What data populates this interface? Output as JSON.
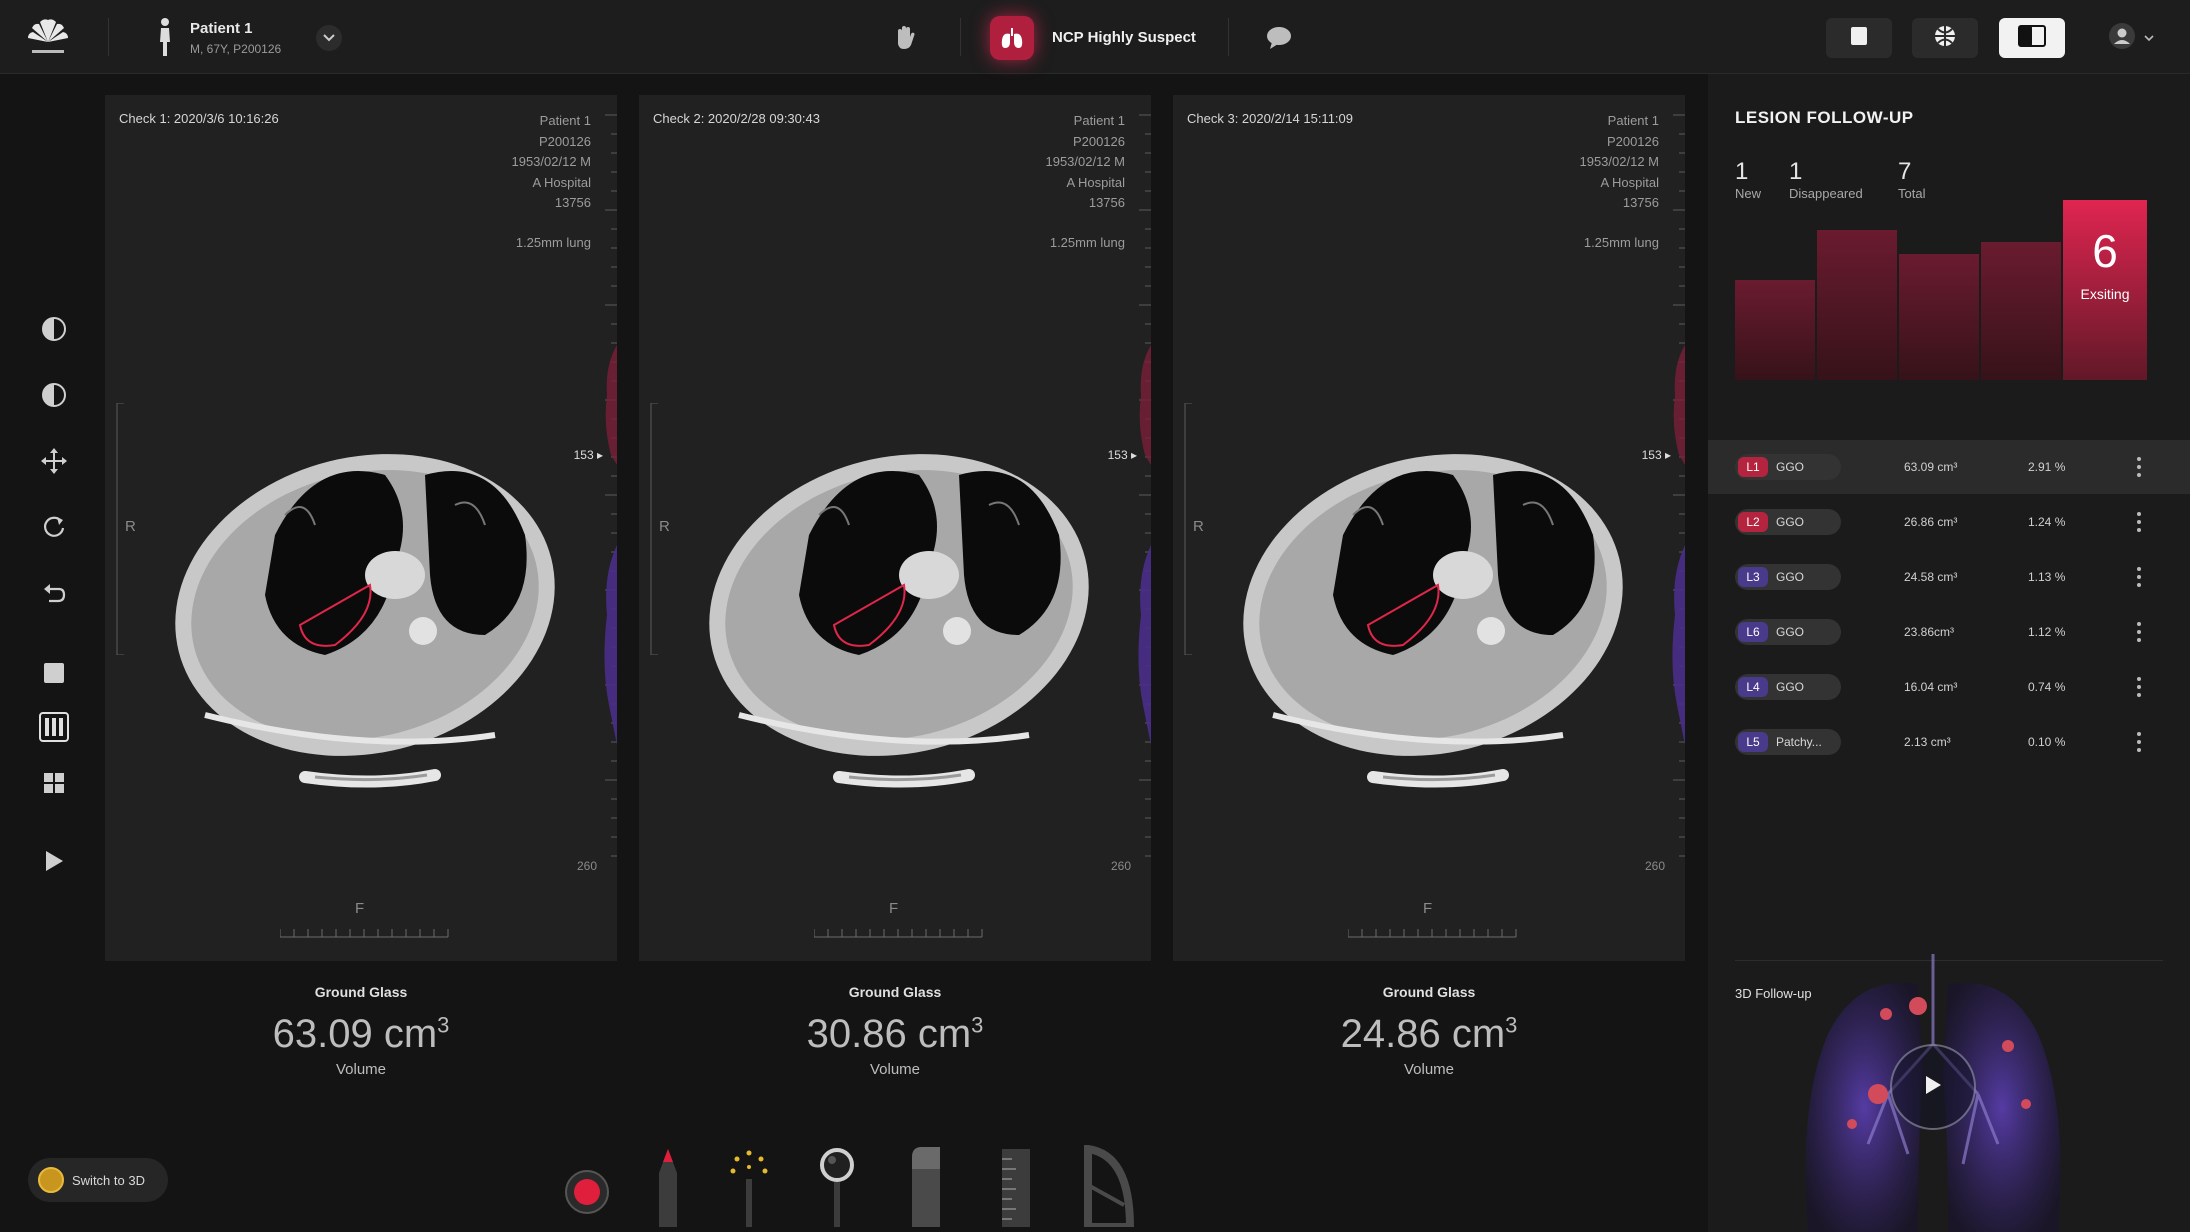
{
  "patient": {
    "name": "Patient 1",
    "meta": "M, 67Y, P200126"
  },
  "status": {
    "text": "NCP  Highly Suspect",
    "color": "#b0203e"
  },
  "viewports": [
    {
      "title": "Check 1: 2020/3/6 10:16:26",
      "info": [
        "Patient 1",
        "P200126",
        "1953/02/12 M",
        "A Hospital",
        "13756"
      ],
      "thickness": "1.25mm lung",
      "slice": "153",
      "slice_end": "260",
      "orient_side": "R",
      "orient_bottom": "F",
      "metric_label": "Ground Glass",
      "metric_value": "63.09 cm",
      "metric_unit_sup": "3",
      "metric_sub": "Volume"
    },
    {
      "title": "Check 2: 2020/2/28 09:30:43",
      "info": [
        "Patient 1",
        "P200126",
        "1953/02/12 M",
        "A Hospital",
        "13756"
      ],
      "thickness": "1.25mm lung",
      "slice": "153",
      "slice_end": "260",
      "orient_side": "R",
      "orient_bottom": "F",
      "metric_label": "Ground Glass",
      "metric_value": "30.86 cm",
      "metric_unit_sup": "3",
      "metric_sub": "Volume"
    },
    {
      "title": "Check 3: 2020/2/14 15:11:09",
      "info": [
        "Patient 1",
        "P200126",
        "1953/02/12 M",
        "A Hospital",
        "13756"
      ],
      "thickness": "1.25mm lung",
      "slice": "153",
      "slice_end": "260",
      "orient_side": "R",
      "orient_bottom": "F",
      "metric_label": "Ground Glass",
      "metric_value": "24.86 cm",
      "metric_unit_sup": "3",
      "metric_sub": "Volume"
    }
  ],
  "followup": {
    "title": "LESION FOLLOW-UP",
    "stats": [
      {
        "n": "1",
        "label": "New"
      },
      {
        "n": "1",
        "label": "Disappeared"
      },
      {
        "n": "7",
        "label": "Total"
      }
    ],
    "existing": {
      "n": "6",
      "label": "Exsiting"
    },
    "lesions": [
      {
        "id": "L1",
        "type": "GGO",
        "volume": "63.09 cm³",
        "percent": "2.91 %",
        "color": "#b4243f"
      },
      {
        "id": "L2",
        "type": "GGO",
        "volume": "26.86 cm³",
        "percent": "1.24 %",
        "color": "#b4243f"
      },
      {
        "id": "L3",
        "type": "GGO",
        "volume": "24.58 cm³",
        "percent": "1.13 %",
        "color": "#4a3a8c"
      },
      {
        "id": "L6",
        "type": "GGO",
        "volume": "23.86cm³",
        "percent": "1.12 %",
        "color": "#4a3a8c"
      },
      {
        "id": "L4",
        "type": "GGO",
        "volume": "16.04 cm³",
        "percent": "0.74 %",
        "color": "#4a3a8c"
      },
      {
        "id": "L5",
        "type": "Patchy...",
        "volume": "2.13 cm³",
        "percent": "0.10 %",
        "color": "#4a3a8c"
      }
    ],
    "followup3d_label": "3D Follow-up"
  },
  "switch3d_label": "Switch to 3D",
  "icons": {
    "logo": "huawei-logo",
    "hand": "hand-icon",
    "lungs": "lungs-icon",
    "chat": "chat-icon",
    "tools": [
      "contrast-icon",
      "invert-icon",
      "move-icon",
      "rotate-icon",
      "undo-icon",
      "single-layout-icon",
      "columns-layout-icon",
      "grid-layout-icon",
      "play-icon"
    ],
    "bottom": [
      "record-icon",
      "pencil-icon",
      "magic-wand-icon",
      "magnifier-icon",
      "eraser-icon",
      "ruler-icon",
      "protractor-icon"
    ]
  }
}
